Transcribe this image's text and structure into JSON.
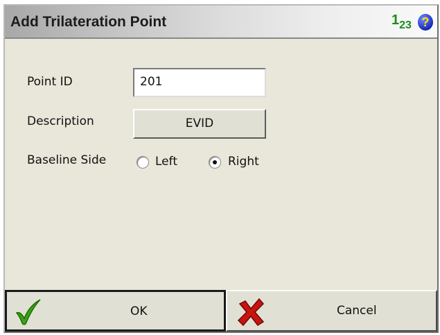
{
  "window": {
    "title": "Add Trilateration Point",
    "numeric_icon": {
      "main": "1",
      "sub": "2",
      "sub2": "3"
    },
    "help_icon_text": "?"
  },
  "form": {
    "point_id": {
      "label": "Point ID",
      "value": "201"
    },
    "description": {
      "label": "Description",
      "button_text": "EVID"
    },
    "baseline_side": {
      "label": "Baseline Side",
      "options": [
        "Left",
        "Right"
      ],
      "selected": "Right"
    }
  },
  "footer": {
    "ok_label": "OK",
    "cancel_label": "Cancel"
  },
  "icons": {
    "ok": "check-icon",
    "cancel": "cross-icon",
    "numeric": "numeric-keypad-icon",
    "help": "help-icon"
  },
  "colors": {
    "dialog_bg": "#e8e7da",
    "check_green": "#3aa312",
    "cross_red": "#c8140f",
    "help_blue": "#1223b8"
  }
}
